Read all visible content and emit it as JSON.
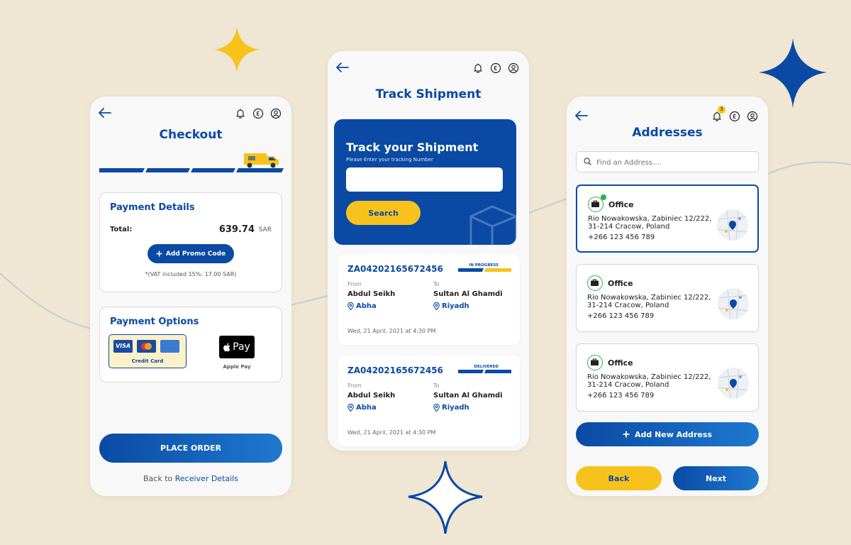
{
  "checkout": {
    "title": "Checkout",
    "payment_details": {
      "title": "Payment Details",
      "total_label": "Total:",
      "total_amount": "639.74",
      "currency": "SAR",
      "promo_button": "Add Promo Code",
      "vat_note": "*(VAT included 15%: 17.00 SAR)"
    },
    "payment_options": {
      "title": "Payment Options",
      "credit_card_label": "Credit Card",
      "visa_text": "VISA",
      "apple_pay_text": "Pay",
      "apple_pay_label": "Apple Pay"
    },
    "place_order": "PLACE ORDER",
    "back_prefix": "Back to",
    "back_link": "Receiver Details"
  },
  "track": {
    "title": "Track Shipment",
    "hero_title": "Track your Shipment",
    "hero_sub": "Please Enter your tracking Number",
    "search_button": "Search",
    "shipments": [
      {
        "id": "ZA04202165672456",
        "status": "IN PROGRESS",
        "from_label": "From",
        "to_label": "To",
        "from_name": "Abdul Seikh",
        "to_name": "Sultan Al Ghamdi",
        "from_city": "Abha",
        "to_city": "Riyadh",
        "date": "Wed, 21 April, 2021 at 4:30 PM"
      },
      {
        "id": "ZA04202165672456",
        "status": "DELIVERED",
        "from_label": "From",
        "to_label": "To",
        "from_name": "Abdul Seikh",
        "to_name": "Sultan Al Ghamdi",
        "from_city": "Abha",
        "to_city": "Riyadh",
        "date": "Wed, 21 April, 2021 at 4:30 PM"
      }
    ]
  },
  "addresses": {
    "title": "Addresses",
    "notification_count": "3",
    "search_placeholder": "Find an Address....",
    "items": [
      {
        "title": "Office",
        "line1": "Rio Nowakowska, Zabiniec 12/222,",
        "line2": "31-214 Cracow, Poland",
        "phone": "+266 123 456 789"
      },
      {
        "title": "Office",
        "line1": "Rio Nowakowska, Zabiniec 12/222,",
        "line2": "31-214 Cracow, Poland",
        "phone": "+266 123 456 789"
      },
      {
        "title": "Office",
        "line1": "Rio Nowakowska, Zabiniec 12/222,",
        "line2": "31-214 Cracow, Poland",
        "phone": "+266 123 456 789"
      }
    ],
    "add_new": "Add New Address",
    "back": "Back",
    "next": "Next"
  },
  "colors": {
    "primary": "#0a4aa4",
    "accent": "#f8c21c",
    "background": "#efe6d3",
    "success": "#2eb24a"
  },
  "icons": [
    "back-arrow-icon",
    "bell-icon",
    "currency-icon",
    "user-icon",
    "delivery-van-icon",
    "plus-icon",
    "mastercard-icon",
    "apple-icon",
    "box-icon",
    "location-pin-icon",
    "search-icon",
    "briefcase-icon",
    "map-icon",
    "sparkle-icon"
  ]
}
